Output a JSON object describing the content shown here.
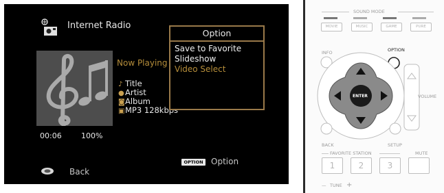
{
  "screen": {
    "app_title": "Internet Radio",
    "now_playing_label": "Now Playing",
    "track": {
      "title": "Title",
      "artist": "Artist",
      "album": "Album",
      "format": "MP3 128kbps"
    },
    "elapsed_time": "00:06",
    "buffer_percent": "100%",
    "option_menu": {
      "header": "Option",
      "items": [
        {
          "label": "Save to Favorite",
          "selected": false
        },
        {
          "label": "Slideshow",
          "selected": false
        },
        {
          "label": "Video Select",
          "selected": true
        }
      ]
    },
    "option_hint": {
      "badge": "OPTION",
      "label": "Option"
    },
    "back_hint": {
      "label": "Back"
    }
  },
  "remote": {
    "sound_mode_label": "SOUND MODE",
    "sound_mode_buttons": [
      "MOVIE",
      "MUSIC",
      "GAME",
      "PURE"
    ],
    "info_label": "INFO",
    "option_label": "OPTION",
    "enter_label": "ENTER",
    "volume_label": "VOLUME",
    "back_label": "BACK",
    "setup_label": "SETUP",
    "favorite_station_label": "FAVORITE STATION",
    "mute_label": "MUTE",
    "number_buttons": [
      "1",
      "2",
      "3"
    ],
    "tune_label": "TUNE"
  },
  "colors": {
    "screen_background": "#000000",
    "accent": "#b58d3a",
    "menu_border": "#9a7a4a",
    "remote_background": "#fbfbfb"
  }
}
